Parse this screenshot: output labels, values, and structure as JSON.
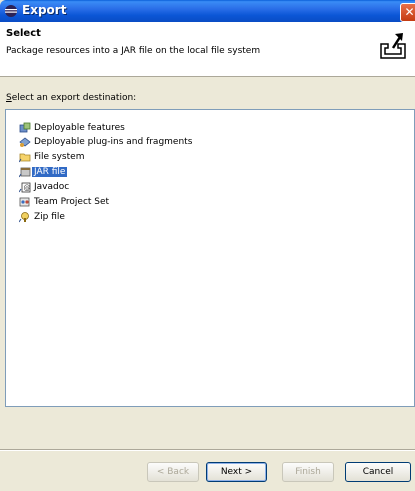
{
  "window": {
    "title": "Export"
  },
  "header": {
    "title": "Select",
    "description": "Package resources into a JAR file on the local file system"
  },
  "list": {
    "label_prefix": "",
    "label_mnemonic": "S",
    "label_rest": "elect an export destination:",
    "items": [
      {
        "label": "Deployable features",
        "icon": "feature-icon",
        "selected": false
      },
      {
        "label": "Deployable plug-ins and fragments",
        "icon": "plugin-icon",
        "selected": false
      },
      {
        "label": "File system",
        "icon": "folder-icon",
        "selected": false
      },
      {
        "label": "JAR file",
        "icon": "jar-icon",
        "selected": true
      },
      {
        "label": "Javadoc",
        "icon": "javadoc-icon",
        "selected": false
      },
      {
        "label": "Team Project Set",
        "icon": "team-icon",
        "selected": false
      },
      {
        "label": "Zip file",
        "icon": "zip-icon",
        "selected": false
      }
    ]
  },
  "buttons": {
    "back": "< Back",
    "next": "Next >",
    "finish": "Finish",
    "cancel": "Cancel"
  },
  "colors": {
    "selection": "#316ac5",
    "titlebar": "#0a56d6",
    "dialog_bg": "#ece9d8"
  }
}
